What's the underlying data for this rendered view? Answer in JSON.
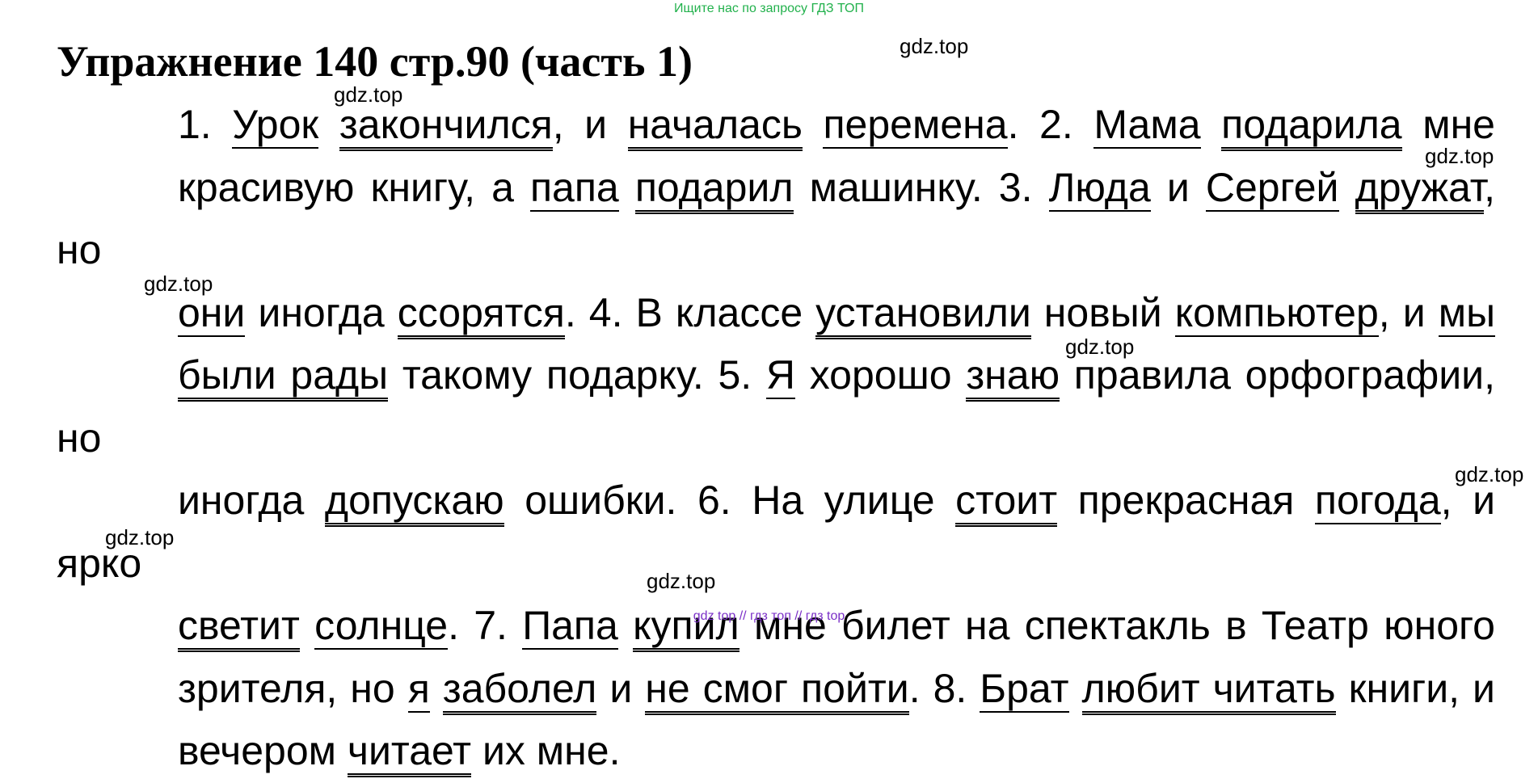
{
  "banner": "Ищите нас по запросу ГДЗ ТОП",
  "title": "Упражнение 140 стр.90 (часть 1)",
  "watermark": "gdz.top",
  "footer": "gdz top  //  гдз топ  //  гдз top",
  "colors": {
    "banner": "#22b14c",
    "footer": "#7a2fc7",
    "text": "#000000"
  },
  "lines": [
    [
      {
        "t": "1. "
      },
      {
        "t": "Урок",
        "u": "s"
      },
      {
        "t": " "
      },
      {
        "t": "закончился",
        "u": "p"
      },
      {
        "t": ", и "
      },
      {
        "t": "началась",
        "u": "p"
      },
      {
        "t": " "
      },
      {
        "t": "перемена",
        "u": "s"
      },
      {
        "t": ". 2. "
      },
      {
        "t": "Мама",
        "u": "s"
      },
      {
        "t": " "
      },
      {
        "t": "подарила",
        "u": "p"
      },
      {
        "t": " мне"
      }
    ],
    [
      {
        "t": "красивую книгу, а "
      },
      {
        "t": "папа",
        "u": "s"
      },
      {
        "t": " "
      },
      {
        "t": "подарил",
        "u": "p"
      },
      {
        "t": " машинку. 3. "
      },
      {
        "t": "Люда",
        "u": "s"
      },
      {
        "t": " и "
      },
      {
        "t": "Сергей",
        "u": "s"
      },
      {
        "t": " "
      },
      {
        "t": "дружат",
        "u": "p"
      },
      {
        "t": ", но"
      }
    ],
    [
      {
        "t": "они",
        "u": "s"
      },
      {
        "t": " иногда "
      },
      {
        "t": "ссорятся",
        "u": "p"
      },
      {
        "t": ". 4. В классе "
      },
      {
        "t": "установили",
        "u": "p"
      },
      {
        "t": " новый "
      },
      {
        "t": "компьютер",
        "u": "s"
      },
      {
        "t": ", и "
      },
      {
        "t": "мы",
        "u": "s"
      }
    ],
    [
      {
        "t": "были рады",
        "u": "p"
      },
      {
        "t": " такому подарку. 5. "
      },
      {
        "t": "Я",
        "u": "s"
      },
      {
        "t": " хорошо "
      },
      {
        "t": "знаю",
        "u": "p"
      },
      {
        "t": " правила орфографии, но"
      }
    ],
    [
      {
        "t": "иногда "
      },
      {
        "t": "допускаю",
        "u": "p"
      },
      {
        "t": " ошибки. 6. На улице "
      },
      {
        "t": "стоит",
        "u": "p"
      },
      {
        "t": " прекрасная "
      },
      {
        "t": "погода",
        "u": "s"
      },
      {
        "t": ", и ярко"
      }
    ],
    [
      {
        "t": "светит",
        "u": "p"
      },
      {
        "t": " "
      },
      {
        "t": "солнце",
        "u": "s"
      },
      {
        "t": ". 7. "
      },
      {
        "t": "Папа",
        "u": "s"
      },
      {
        "t": " "
      },
      {
        "t": "купил",
        "u": "p"
      },
      {
        "t": " мне билет на спектакль в Театр юного"
      }
    ],
    [
      {
        "t": "зрителя, но "
      },
      {
        "t": "я",
        "u": "s"
      },
      {
        "t": " "
      },
      {
        "t": "заболел",
        "u": "p"
      },
      {
        "t": " и "
      },
      {
        "t": "не смог пойти",
        "u": "p"
      },
      {
        "t": ". 8. "
      },
      {
        "t": "Брат",
        "u": "s"
      },
      {
        "t": " "
      },
      {
        "t": "любит читать",
        "u": "p"
      },
      {
        "t": " книги, и"
      }
    ],
    [
      {
        "t": "вечером "
      },
      {
        "t": "читает",
        "u": "p"
      },
      {
        "t": " их мне."
      }
    ]
  ]
}
